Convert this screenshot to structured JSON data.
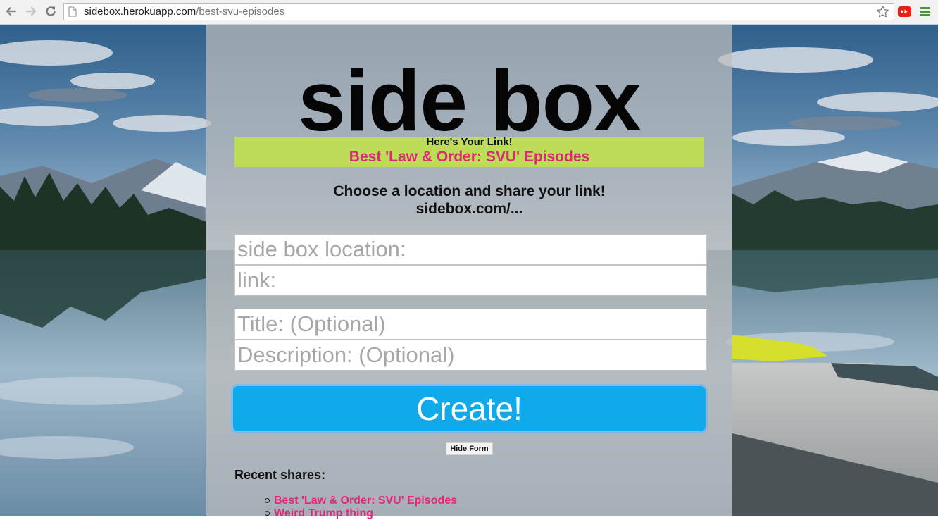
{
  "browser": {
    "url_host": "sidebox.herokuapp.com",
    "url_path": "/best-svu-episodes",
    "icons": [
      "back-arrow-icon",
      "forward-arrow-icon",
      "reload-icon",
      "page-icon",
      "star-icon",
      "youtube-icon",
      "menu-icon"
    ]
  },
  "page": {
    "logo": "side box",
    "banner": {
      "title": "Here's Your Link!",
      "link": "Best 'Law & Order: SVU' Episodes"
    },
    "instruction_line1": "Choose a location and share your link!",
    "instruction_line2": "sidebox.com/...",
    "form": {
      "location_placeholder": "side box location:",
      "link_placeholder": "link:",
      "title_placeholder": "Title: (Optional)",
      "description_placeholder": "Description: (Optional)",
      "create_label": "Create!",
      "hide_label": "Hide Form"
    },
    "recent": {
      "heading": "Recent shares:",
      "items": [
        "Best 'Law & Order: SVU' Episodes",
        "Weird Trump thing"
      ]
    }
  },
  "colors": {
    "banner_bg": "#bedc58",
    "link": "#e0287a",
    "button": "#10aaea"
  }
}
